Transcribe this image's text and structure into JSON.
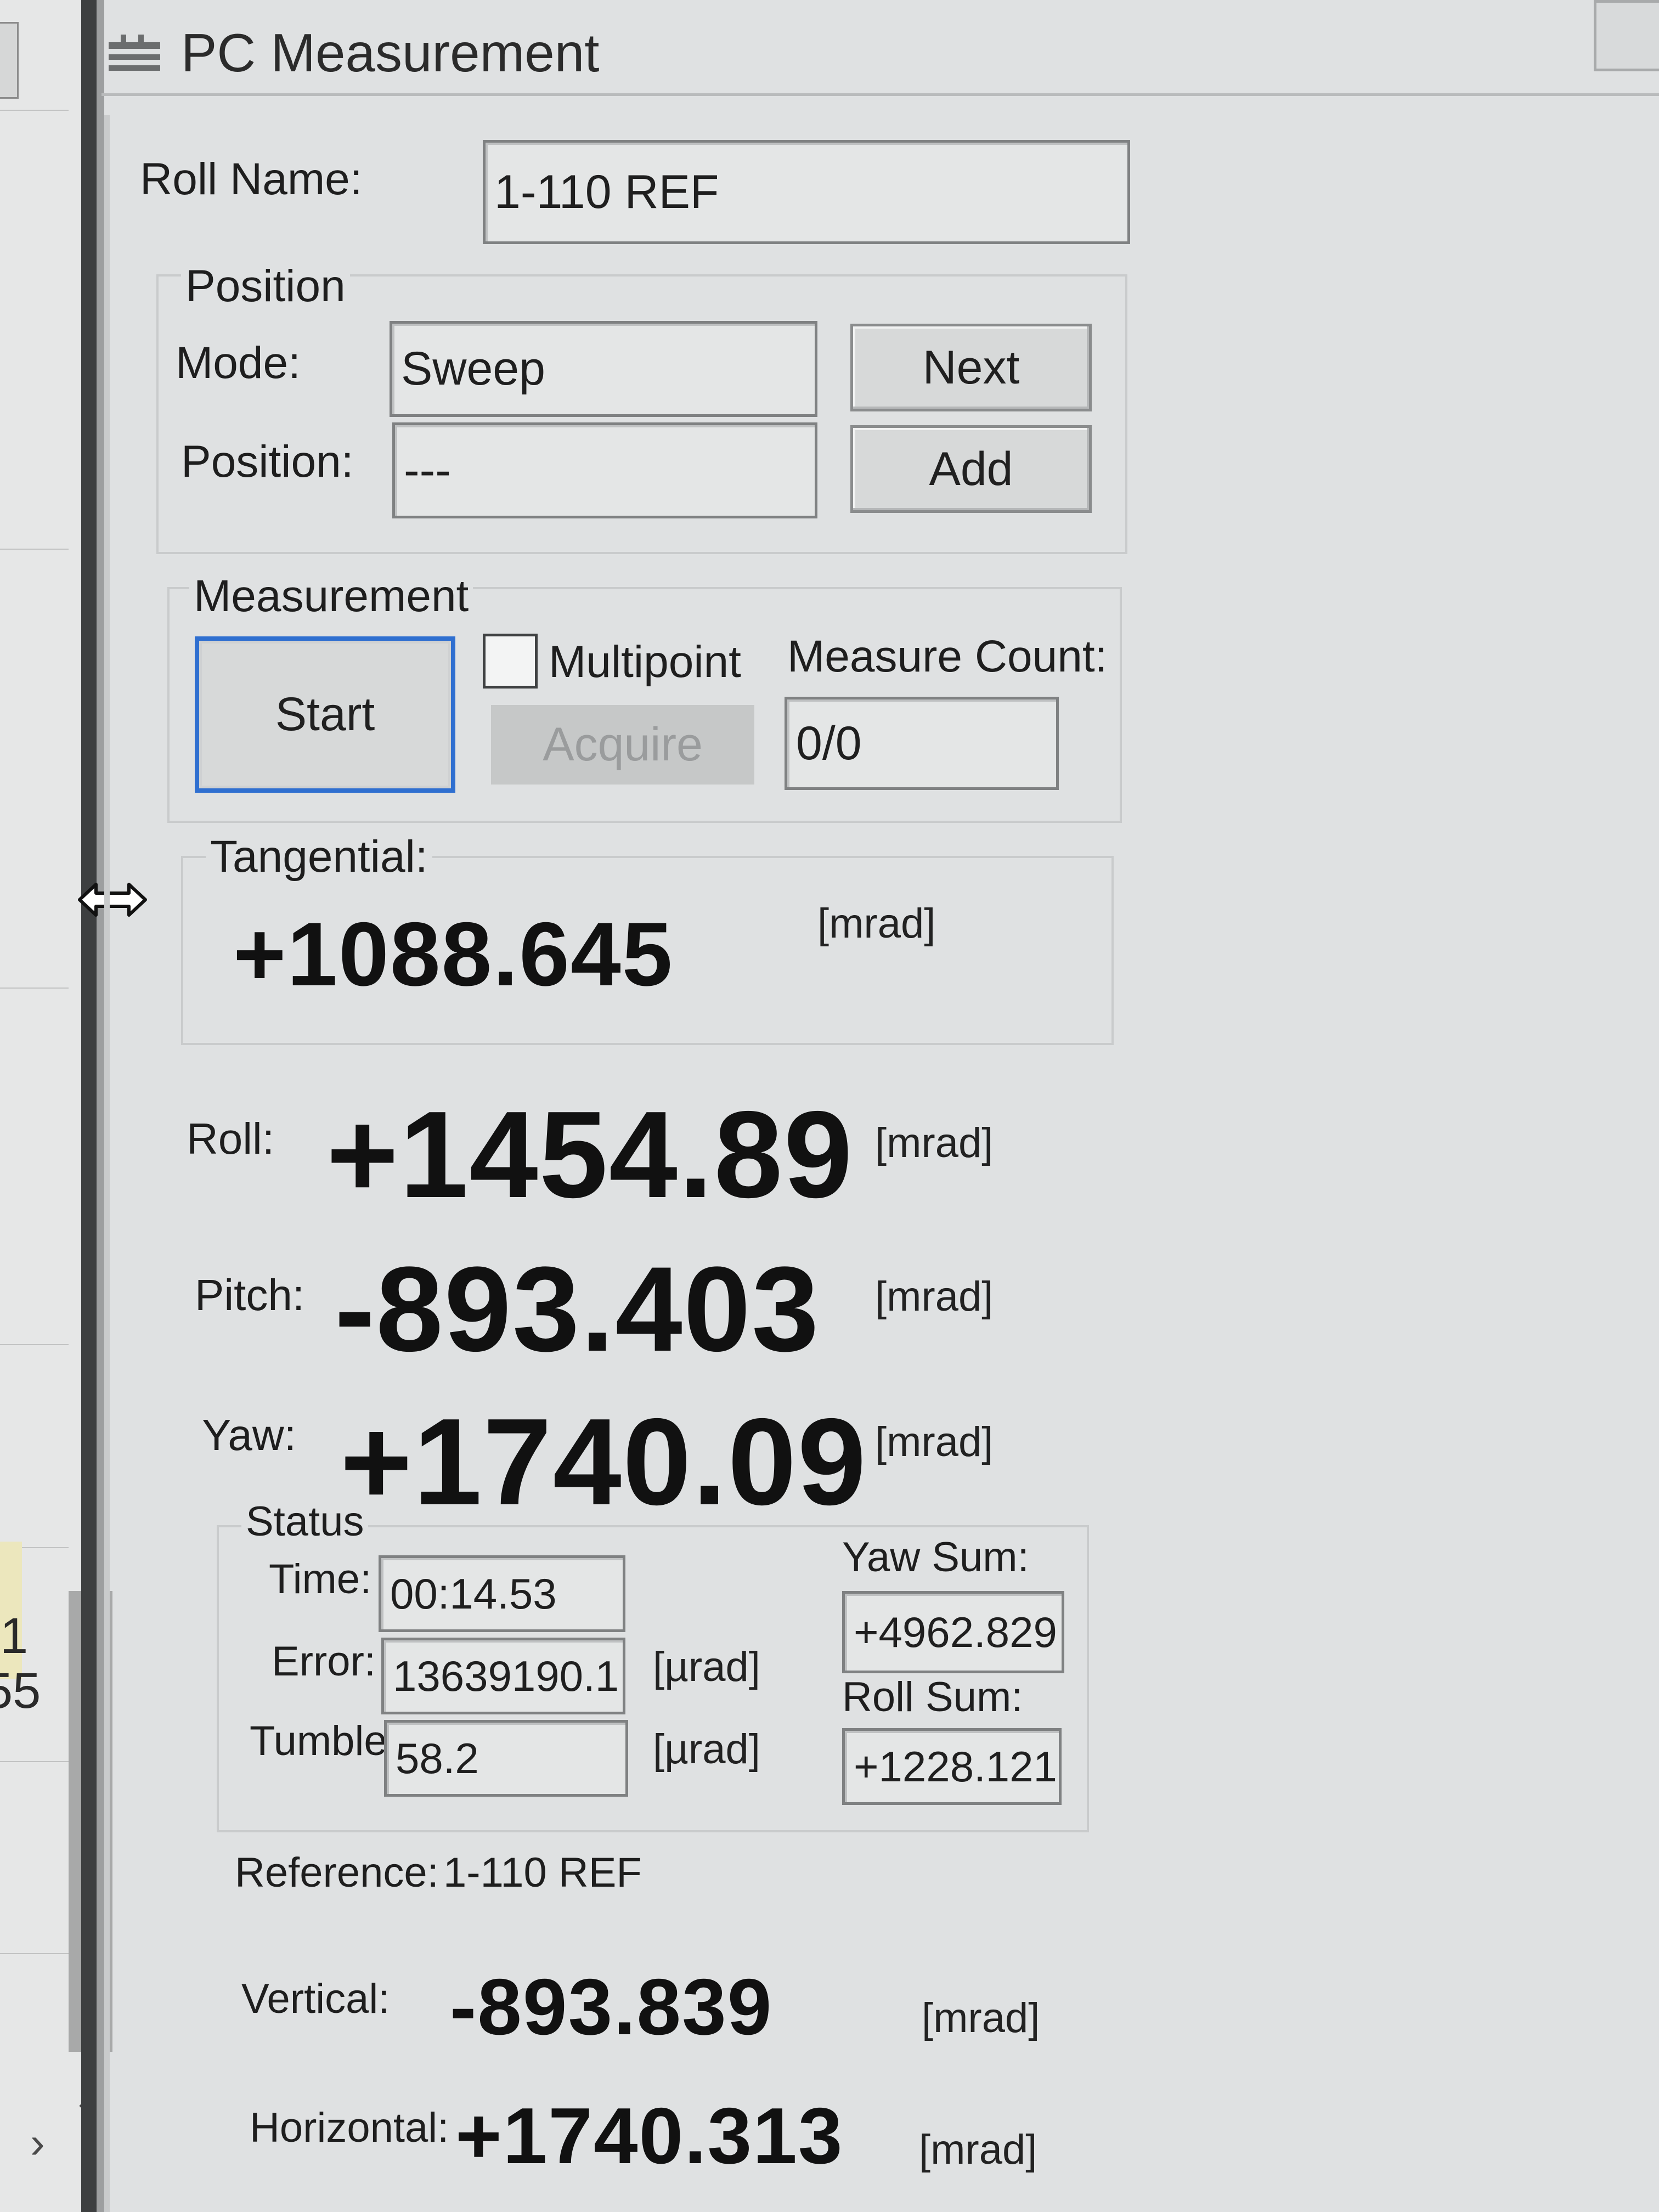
{
  "window": {
    "title": "PC Measurement"
  },
  "background_app": {
    "cell_1": "1",
    "cell_2": "55"
  },
  "roll_name": {
    "label": "Roll Name:",
    "value": "1-110 REF"
  },
  "position": {
    "group_label": "Position",
    "mode_label": "Mode:",
    "mode_value": "Sweep",
    "next_button": "Next",
    "position_label": "Position:",
    "position_value": "---",
    "add_button": "Add"
  },
  "measurement": {
    "group_label": "Measurement",
    "start_button": "Start",
    "multipoint_label": "Multipoint",
    "multipoint_checked": false,
    "acquire_button": "Acquire",
    "measure_count_label": "Measure Count:",
    "measure_count_value": "0/0"
  },
  "tangential": {
    "label": "Tangential:",
    "value": "+1088.645",
    "unit": "[mrad]"
  },
  "roll": {
    "label": "Roll:",
    "value": "+1454.89",
    "unit": "[mrad]"
  },
  "pitch": {
    "label": "Pitch:",
    "value": "-893.403",
    "unit": "[mrad]"
  },
  "yaw": {
    "label": "Yaw:",
    "value": "+1740.09",
    "unit": "[mrad]"
  },
  "status": {
    "group_label": "Status",
    "time_label": "Time:",
    "time_value": "00:14.53",
    "error_label": "Error:",
    "error_value": "13639190.1",
    "error_unit": "[µrad]",
    "tumble_label": "Tumble",
    "tumble_value": "58.2",
    "tumble_unit": "[µrad]",
    "yaw_sum_label": "Yaw Sum:",
    "yaw_sum_value": "+4962.829",
    "roll_sum_label": "Roll Sum:",
    "roll_sum_value": "+1228.121"
  },
  "reference": {
    "label": "Reference:",
    "value": "1-110 REF"
  },
  "vertical": {
    "label": "Vertical:",
    "value": "-893.839",
    "unit": "[mrad]"
  },
  "horizontal": {
    "label": "Horizontal:",
    "value": "+1740.313",
    "unit": "[mrad]"
  },
  "colors": {
    "focus_border": "#2f6fd0",
    "background": "#dfe1e2"
  }
}
